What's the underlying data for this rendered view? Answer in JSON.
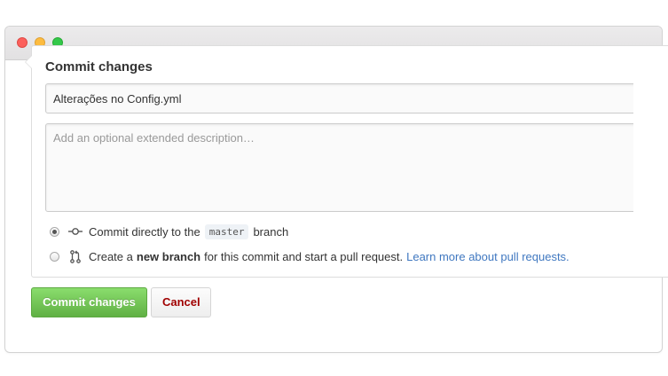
{
  "window": {
    "controls": [
      "close",
      "minimize",
      "zoom"
    ]
  },
  "commit_form": {
    "title": "Commit changes",
    "summary_value": "Alterações no Config.yml",
    "description_placeholder": "Add an optional extended description…",
    "options": {
      "direct": {
        "selected": true,
        "text_before": "Commit directly to the",
        "branch": "master",
        "text_after": "branch",
        "icon": "git-commit-icon"
      },
      "new_branch": {
        "selected": false,
        "text_before": "Create a",
        "text_bold": "new branch",
        "text_after": "for this commit and start a pull request.",
        "link": "Learn more about pull requests.",
        "icon": "git-pull-request-icon"
      }
    }
  },
  "actions": {
    "commit_label": "Commit changes",
    "cancel_label": "Cancel"
  },
  "colors": {
    "primary_button": "#60b044",
    "cancel_text": "#a00000",
    "link": "#4078c0"
  }
}
